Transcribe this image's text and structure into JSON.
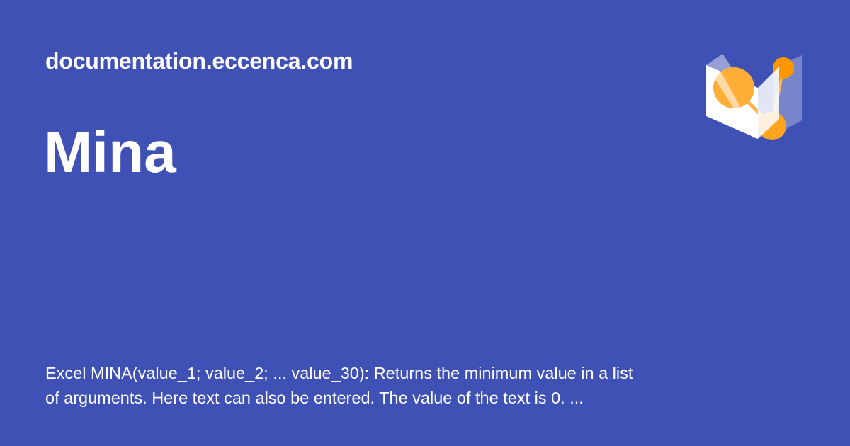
{
  "site": {
    "name": "documentation.eccenca.com",
    "logo": "eccenca-logo-icon"
  },
  "page": {
    "title": "Mina",
    "description": "Excel MINA(value_1; value_2; ... value_30): Returns the minimum value in a list of arguments. Here text can also be entered. The value of the text is 0. ..."
  },
  "colors": {
    "background": "#3f51b5",
    "text": "#ffffff",
    "accent": "#ff9800"
  }
}
